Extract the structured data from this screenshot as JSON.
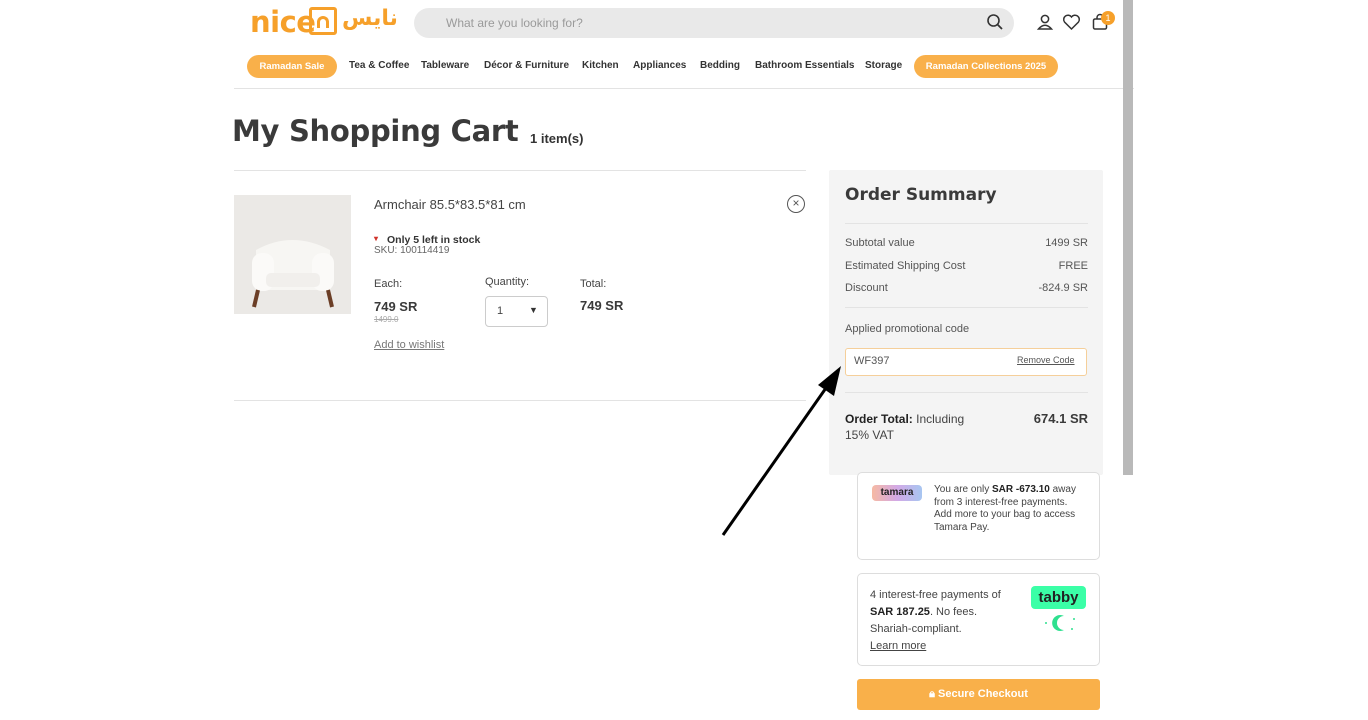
{
  "header": {
    "logo_en": "nice",
    "logo_ar": "نايس",
    "search_placeholder": "What are you looking for?",
    "cart_count": "1"
  },
  "nav": {
    "ramadan_sale": "Ramadan Sale",
    "items": [
      "Tea & Coffee",
      "Tableware",
      "Décor & Furniture",
      "Kitchen",
      "Appliances",
      "Bedding",
      "Bathroom Essentials",
      "Storage"
    ],
    "ramadan_collections": "Ramadan Collections 2025"
  },
  "cart": {
    "title": "My Shopping Cart",
    "count": "1 item(s)",
    "item": {
      "name": "Armchair 85.5*83.5*81 cm",
      "stock": "Only 5 left in stock",
      "sku": "SKU: 100114419",
      "each_label": "Each:",
      "price": "749 SR",
      "old_price": "1499.0",
      "qty_label": "Quantity:",
      "qty": "1",
      "total_label": "Total:",
      "total": "749 SR",
      "wishlist": "Add to wishlist"
    }
  },
  "summary": {
    "title": "Order Summary",
    "subtotal_label": "Subtotal value",
    "subtotal": "1499 SR",
    "shipping_label": "Estimated Shipping Cost",
    "shipping": "FREE",
    "discount_label": "Discount",
    "discount": "-824.9 SR",
    "promo_label": "Applied promotional code",
    "promo_code": "WF397",
    "remove_code": "Remove Code",
    "total_label": "Order Total:",
    "total_note": "Including 15% VAT",
    "total": "674.1 SR"
  },
  "tamara": {
    "logo": "tamara",
    "text_prefix": "You are only ",
    "amount": "SAR -673.10",
    "text_suffix": " away from 3 interest-free payments. Add more to your bag to access Tamara Pay."
  },
  "tabby": {
    "logo": "tabby",
    "text_prefix": "4 interest-free payments of ",
    "amount": "SAR 187.25",
    "text_suffix": ". No fees. Shariah-compliant.",
    "learn_more": "Learn more"
  },
  "checkout": {
    "label": "Secure Checkout"
  },
  "colors": {
    "brand": "#f6a02a",
    "pill": "#f9b04a",
    "tabby": "#3bffa7"
  }
}
